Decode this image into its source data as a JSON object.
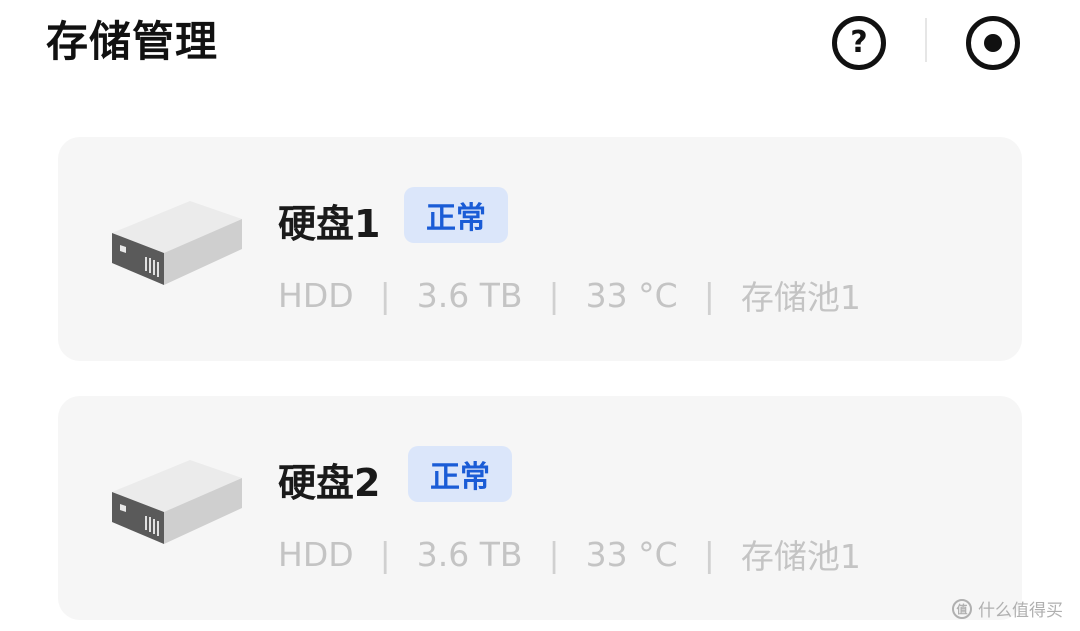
{
  "header": {
    "title": "存储管理",
    "help_icon": "question-circle-icon",
    "help_glyph": "?",
    "record_icon": "record-circle-icon"
  },
  "disks": [
    {
      "name": "硬盘1",
      "status": "正常",
      "type": "HDD",
      "capacity": "3.6 TB",
      "temperature": "33 °C",
      "pool": "存储池1",
      "separator": "|",
      "icon": "hard-drive-icon"
    },
    {
      "name": "硬盘2",
      "status": "正常",
      "type": "HDD",
      "capacity": "3.6 TB",
      "temperature": "33 °C",
      "pool": "存储池1",
      "separator": "|",
      "icon": "hard-drive-icon"
    }
  ],
  "watermark": {
    "text": "什么值得买",
    "icon_glyph": "值"
  },
  "colors": {
    "status_badge_bg": "#dbe6fa",
    "status_badge_text": "#1a5cd6",
    "card_bg": "#f6f6f6",
    "meta_text": "#c4c4c4"
  }
}
